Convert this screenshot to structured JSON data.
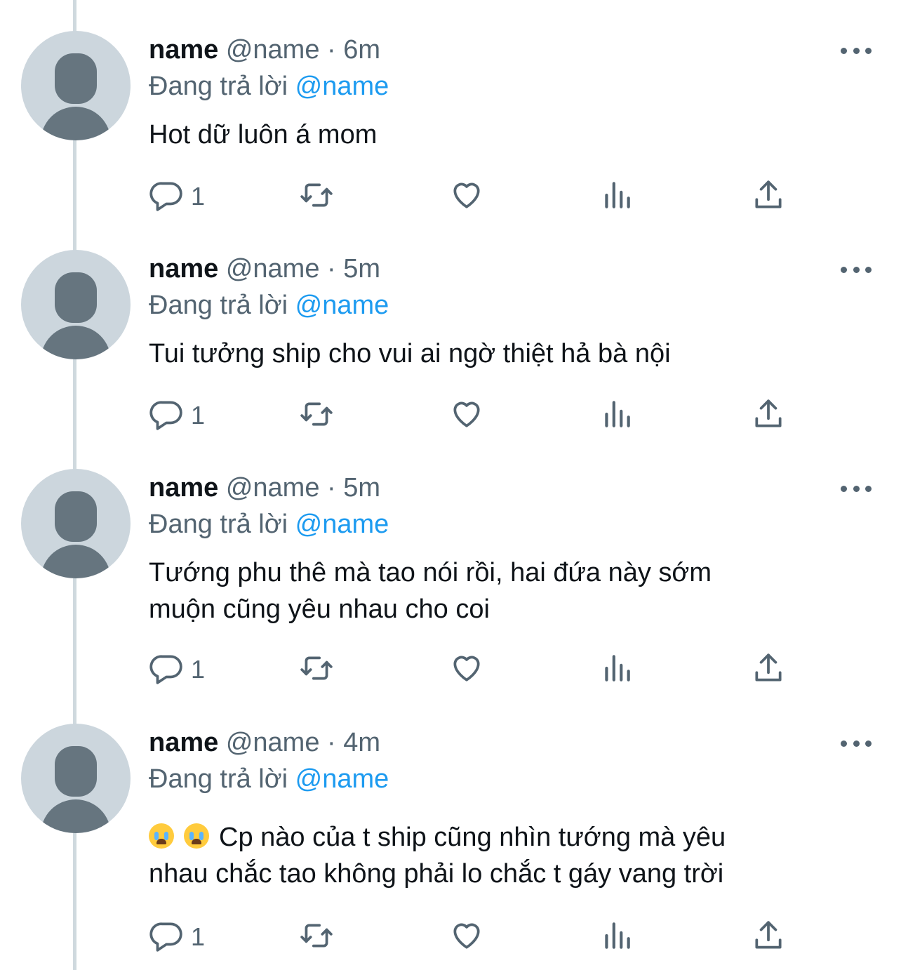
{
  "tweets": [
    {
      "display_name": "name",
      "handle": "@name",
      "separator": "·",
      "time": "6m",
      "replying_prefix": "Đang trả lời",
      "replying_to": "@name",
      "text_lines": [
        "Hot dữ luôn á mom"
      ],
      "reply_count": "1"
    },
    {
      "display_name": "name",
      "handle": "@name",
      "separator": "·",
      "time": "5m",
      "replying_prefix": "Đang trả lời",
      "replying_to": "@name",
      "text_lines": [
        "Tui tưởng ship cho vui ai ngờ thiệt hả bà nội"
      ],
      "reply_count": "1"
    },
    {
      "display_name": "name",
      "handle": "@name",
      "separator": "·",
      "time": "5m",
      "replying_prefix": "Đang trả lời",
      "replying_to": "@name",
      "text_lines": [
        "Tướng phu thê mà tao nói rồi, hai đứa này sớm",
        "muộn cũng yêu nhau cho coi"
      ],
      "reply_count": "1"
    },
    {
      "display_name": "name",
      "handle": "@name",
      "separator": "·",
      "time": "4m",
      "replying_prefix": "Đang trả lời",
      "replying_to": "@name",
      "emoji_prefix": [
        "loudly-crying-face",
        "loudly-crying-face"
      ],
      "text_lines": [
        "Cp nào của t ship cũng nhìn tướng mà yêu",
        "nhau chắc tao không phải lo chắc t gáy vang trời"
      ],
      "reply_count": "1"
    }
  ],
  "icons": {
    "reply": "reply-icon",
    "retweet": "retweet-icon",
    "like": "like-icon",
    "views": "views-icon",
    "share": "share-icon",
    "more": "more-icon"
  },
  "colors": {
    "mention": "#1d9bf0",
    "secondary_text": "#536471",
    "primary_text": "#0f1419",
    "avatar_bg": "#ccd6dd",
    "avatar_fg": "#66757f",
    "thread_line": "#cfd9de"
  }
}
